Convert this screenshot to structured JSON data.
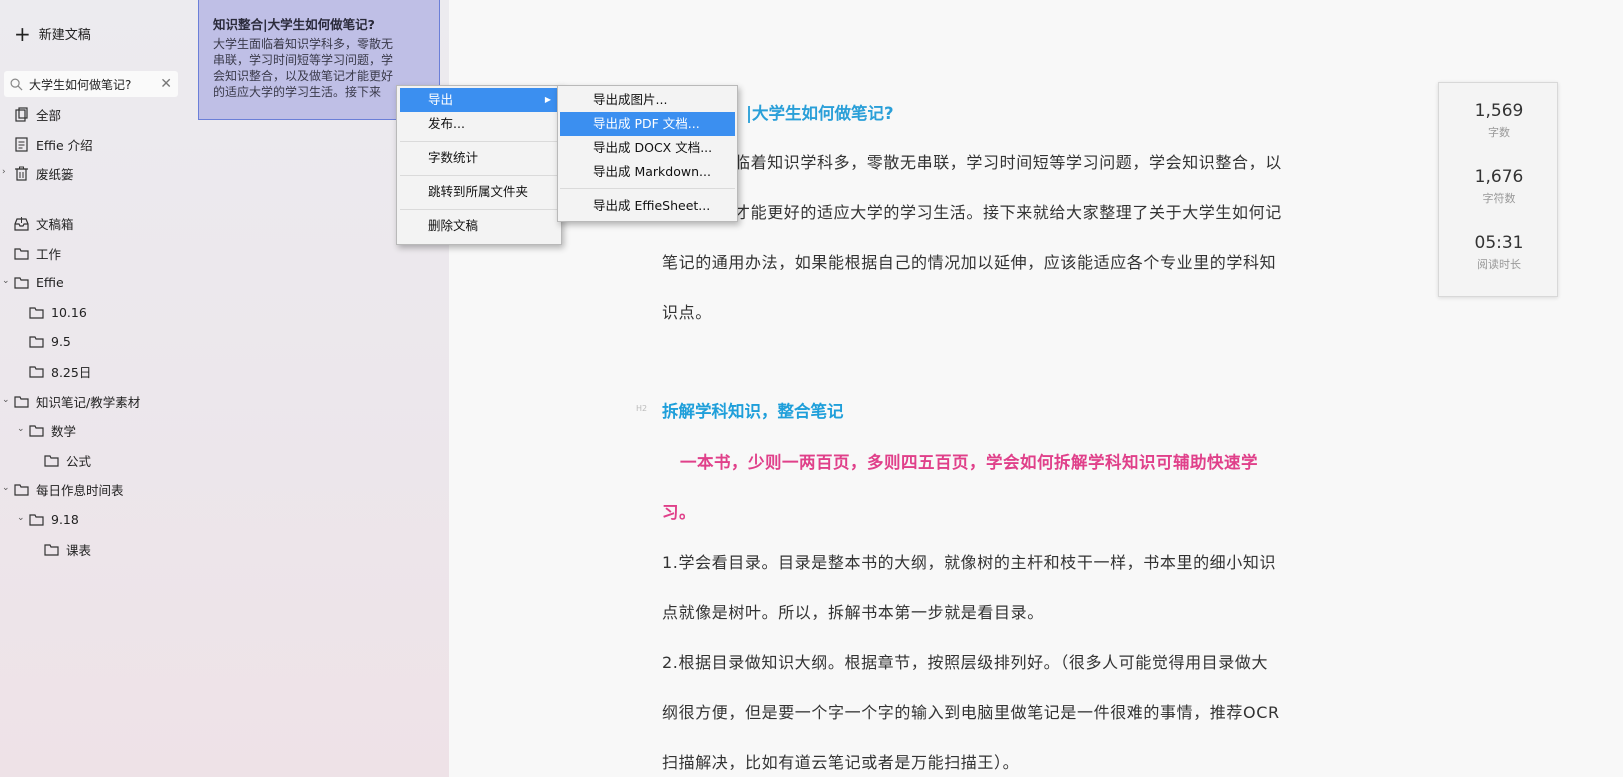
{
  "sidebar": {
    "new_doc_label": "新建文稿",
    "search_value": "大学生如何做笔记?",
    "items": [
      {
        "label": "全部"
      },
      {
        "label": "Effie 介绍"
      },
      {
        "label": "废纸篓"
      },
      {
        "label": "文稿箱"
      },
      {
        "label": "工作"
      },
      {
        "label": "Effie"
      },
      {
        "label": "10.16"
      },
      {
        "label": "9.5"
      },
      {
        "label": "8.25日"
      },
      {
        "label": "知识笔记/教学素材"
      },
      {
        "label": "数学"
      },
      {
        "label": "公式"
      },
      {
        "label": "每日作息时间表"
      },
      {
        "label": "9.18"
      },
      {
        "label": "课表"
      }
    ]
  },
  "doc_card": {
    "title": "知识整合|大学生如何做笔记?",
    "lines": [
      "大学生面临着知识学科多，零散无",
      "串联，学习时间短等学习问题，学",
      "会知识整合，以及做笔记才能更好",
      "的适应大学的学习生活。接下来"
    ]
  },
  "context_menu": {
    "items": [
      "导出",
      "发布...",
      "字数统计",
      "跳转到所属文件夹",
      "删除文稿"
    ]
  },
  "export_submenu": {
    "items": [
      "导出成图片...",
      "导出成 PDF 文档...",
      "导出成 DOCX 文档...",
      "导出成 Markdown...",
      "导出成 EffieSheet..."
    ]
  },
  "editor": {
    "title_fragment": "|大学生如何做笔记?",
    "intro_lines": [
      "临着知识学科多，零散无串联，学习时间短等学习问题，学会知识整合，以",
      "才能更好的适应大学的学习生活。接下来就给大家整理了关于大学生如何记",
      "笔记的通用办法，如果能根据自己的情况加以延伸，应该能适应各个专业里的学科知",
      "识点。"
    ],
    "heading2": "拆解学科知识，整合笔记",
    "heading2_mark": "H2",
    "highlight_lines": [
      "一本书，少则一两百页，多则四五百页，学会如何拆解学科知识可辅助快速学",
      "习。"
    ],
    "body_lines": [
      "1.学会看目录。目录是整本书的大纲，就像树的主杆和枝干一样，书本里的细小知识",
      "点就像是树叶。所以，拆解书本第一步就是看目录。",
      "2.根据目录做知识大纲。根据章节，按照层级排列好。（很多人可能觉得用目录做大",
      "纲很方便，但是要一个字一个字的输入到电脑里做笔记是一件很难的事情，推荐OCR",
      "扫描解决，比如有道云笔记或者是万能扫描王）。"
    ]
  },
  "stats": {
    "words_value": "1,569",
    "words_label": "字数",
    "chars_value": "1,676",
    "chars_label": "字符数",
    "read_value": "05:31",
    "read_label": "阅读时长"
  }
}
